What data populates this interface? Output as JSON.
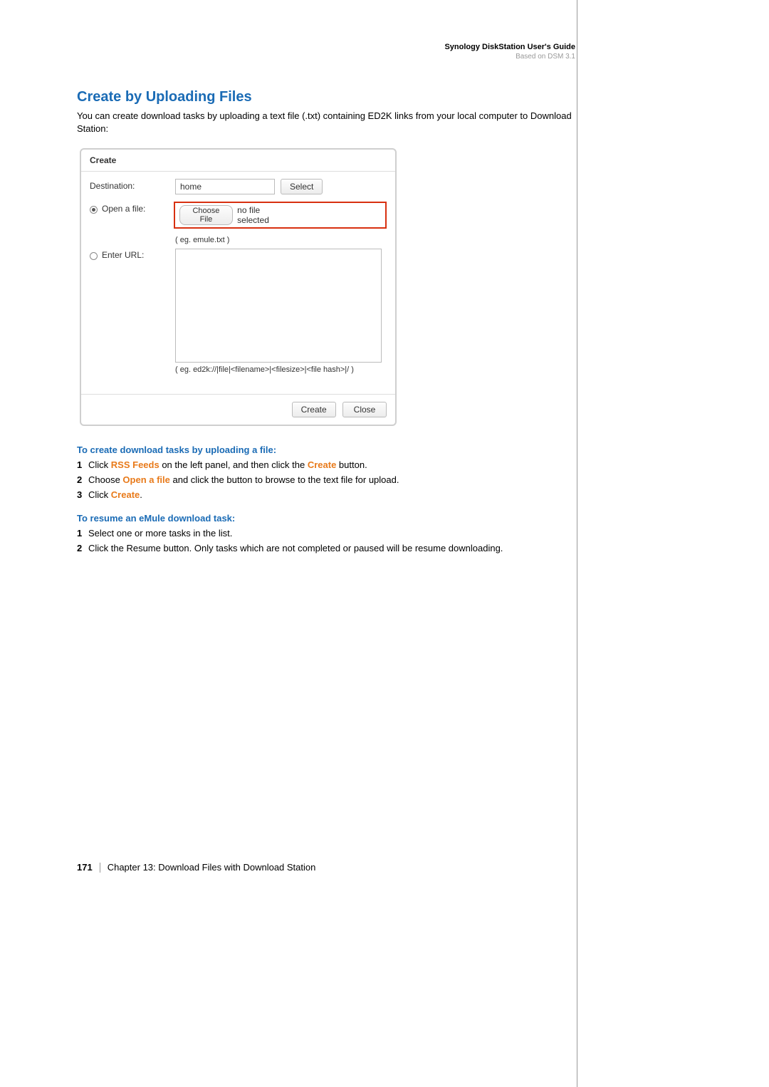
{
  "header": {
    "title": "Synology DiskStation User's Guide",
    "subtitle": "Based on DSM 3.1"
  },
  "section": {
    "heading": "Create by Uploading Files",
    "intro": "You can create download tasks by uploading a text file (.txt) containing ED2K links from your local computer to Download Station:"
  },
  "dialog": {
    "title": "Create",
    "destination_label": "Destination:",
    "destination_value": "home",
    "select_btn": "Select",
    "open_file_label": "Open a file:",
    "choose_file_btn": "Choose File",
    "no_file_text": "no file selected",
    "enter_url_label": "Enter URL:",
    "file_hint": "( eg. emule.txt )",
    "url_hint": "( eg. ed2k://|file|<filename>|<filesize>|<file hash>|/ )",
    "create_btn": "Create",
    "close_btn": "Close"
  },
  "instructions1": {
    "heading": "To create download tasks by uploading a file:",
    "steps": [
      {
        "pre": "Click ",
        "em1": "RSS Feeds",
        "mid": " on the left panel, and then click the ",
        "em2": "Create",
        "post": " button."
      },
      {
        "pre": "Choose ",
        "em1": "Open a file",
        "mid": " and click the button to browse to the text file for upload.",
        "em2": "",
        "post": ""
      },
      {
        "pre": "Click ",
        "em1": "Create",
        "mid": ".",
        "em2": "",
        "post": ""
      }
    ]
  },
  "instructions2": {
    "heading": "To resume an eMule download task:",
    "steps": [
      "Select one or more tasks in the list.",
      "Click the Resume button. Only tasks which are not completed or paused will be resume downloading."
    ]
  },
  "footer": {
    "page_number": "171",
    "chapter": "Chapter 13: Download Files with Download Station"
  }
}
